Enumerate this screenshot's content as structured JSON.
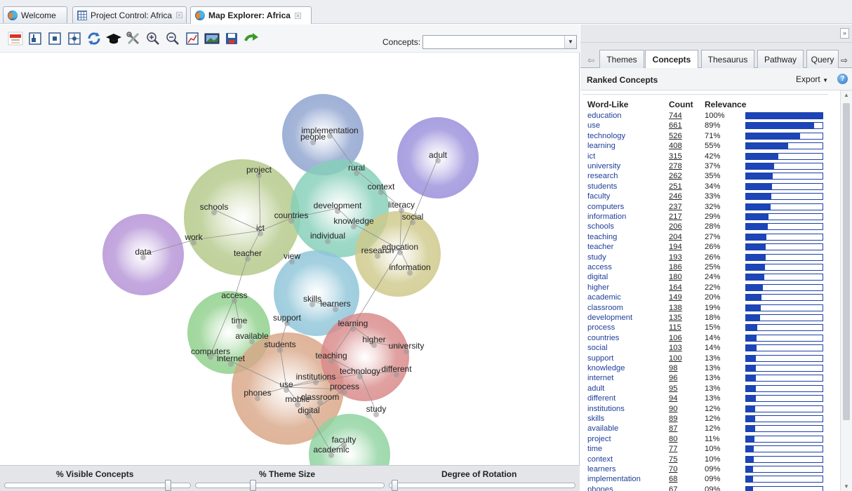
{
  "doc_tabs": [
    {
      "label": "Welcome",
      "icon": "globe-icon",
      "closable": false
    },
    {
      "label": "Project Control: Africa",
      "icon": "table-icon",
      "closable": true
    },
    {
      "label": "Map Explorer: Africa",
      "icon": "globe-icon",
      "closable": true,
      "active": true
    }
  ],
  "toolbar": {
    "concepts_label": "Concepts:",
    "concepts_value": "",
    "icons": [
      "logo-icon",
      "fit-icon",
      "frame-icon",
      "center-icon",
      "refresh-icon",
      "graduation-cap-icon",
      "tools-icon",
      "zoom-in-icon",
      "zoom-out-icon",
      "chart-icon",
      "image-icon",
      "save-icon",
      "forward-arrow-icon"
    ]
  },
  "map": {
    "themes": [
      {
        "name": "implementation",
        "color": "#8ea3cf"
      },
      {
        "name": "adult",
        "color": "#9a8fdb"
      },
      {
        "name": "project",
        "color": "#b5c98a"
      },
      {
        "name": "development",
        "color": "#86cfb9"
      },
      {
        "name": "social",
        "color": "#cfc98a"
      },
      {
        "name": "data",
        "color": "#b593d6"
      },
      {
        "name": "skills",
        "color": "#8fc5d9"
      },
      {
        "name": "access",
        "color": "#8fd08b"
      },
      {
        "name": "use",
        "color": "#d9a788"
      },
      {
        "name": "learning",
        "color": "#d98a8a"
      },
      {
        "name": "study",
        "color": "#8fd3a0"
      }
    ],
    "concepts": [
      "implementation",
      "people",
      "adult",
      "project",
      "rural",
      "context",
      "schools",
      "development",
      "literacy",
      "countries",
      "knowledge",
      "social",
      "ict",
      "work",
      "individual",
      "data",
      "teacher",
      "research",
      "education",
      "view",
      "information",
      "access",
      "skills",
      "learners",
      "support",
      "learning",
      "time",
      "available",
      "higher",
      "university",
      "students",
      "computers",
      "internet",
      "teaching",
      "different",
      "technology",
      "institutions",
      "use",
      "process",
      "phones",
      "mobile",
      "classroom",
      "digital",
      "study",
      "faculty",
      "academic"
    ]
  },
  "bottom": {
    "visible_label": "% Visible Concepts",
    "theme_label": "% Theme Size",
    "rotation_label": "Degree of Rotation",
    "visible_value": 0.9,
    "theme_value": 0.3,
    "rotation_value": 0.01
  },
  "right": {
    "tabs": [
      "Themes",
      "Concepts",
      "Thesaurus",
      "Pathway",
      "Query"
    ],
    "active_tab": "Concepts",
    "panel_title": "Ranked Concepts",
    "export_label": "Export",
    "headers": {
      "word": "Word-Like",
      "count": "Count",
      "relevance": "Relevance"
    },
    "rows": [
      {
        "word": "education",
        "count": "744",
        "relevance": "100%",
        "pct": 100
      },
      {
        "word": "use",
        "count": "661",
        "relevance": "89%",
        "pct": 89
      },
      {
        "word": "technology",
        "count": "526",
        "relevance": "71%",
        "pct": 71
      },
      {
        "word": "learning",
        "count": "408",
        "relevance": "55%",
        "pct": 55
      },
      {
        "word": "ict",
        "count": "315",
        "relevance": "42%",
        "pct": 42
      },
      {
        "word": "university",
        "count": "278",
        "relevance": "37%",
        "pct": 37
      },
      {
        "word": "research",
        "count": "262",
        "relevance": "35%",
        "pct": 35
      },
      {
        "word": "students",
        "count": "251",
        "relevance": "34%",
        "pct": 34
      },
      {
        "word": "faculty",
        "count": "246",
        "relevance": "33%",
        "pct": 33
      },
      {
        "word": "computers",
        "count": "237",
        "relevance": "32%",
        "pct": 32
      },
      {
        "word": "information",
        "count": "217",
        "relevance": "29%",
        "pct": 29
      },
      {
        "word": "schools",
        "count": "206",
        "relevance": "28%",
        "pct": 28
      },
      {
        "word": "teaching",
        "count": "204",
        "relevance": "27%",
        "pct": 27
      },
      {
        "word": "teacher",
        "count": "194",
        "relevance": "26%",
        "pct": 26
      },
      {
        "word": "study",
        "count": "193",
        "relevance": "26%",
        "pct": 26
      },
      {
        "word": "access",
        "count": "186",
        "relevance": "25%",
        "pct": 25
      },
      {
        "word": "digital",
        "count": "180",
        "relevance": "24%",
        "pct": 24
      },
      {
        "word": "higher",
        "count": "164",
        "relevance": "22%",
        "pct": 22
      },
      {
        "word": "academic",
        "count": "149",
        "relevance": "20%",
        "pct": 20
      },
      {
        "word": "classroom",
        "count": "138",
        "relevance": "19%",
        "pct": 19
      },
      {
        "word": "development",
        "count": "135",
        "relevance": "18%",
        "pct": 18
      },
      {
        "word": "process",
        "count": "115",
        "relevance": "15%",
        "pct": 15
      },
      {
        "word": "countries",
        "count": "106",
        "relevance": "14%",
        "pct": 14
      },
      {
        "word": "social",
        "count": "103",
        "relevance": "14%",
        "pct": 14
      },
      {
        "word": "support",
        "count": "100",
        "relevance": "13%",
        "pct": 13
      },
      {
        "word": "knowledge",
        "count": "98",
        "relevance": "13%",
        "pct": 13
      },
      {
        "word": "internet",
        "count": "96",
        "relevance": "13%",
        "pct": 13
      },
      {
        "word": "adult",
        "count": "95",
        "relevance": "13%",
        "pct": 13
      },
      {
        "word": "different",
        "count": "94",
        "relevance": "13%",
        "pct": 13
      },
      {
        "word": "institutions",
        "count": "90",
        "relevance": "12%",
        "pct": 12
      },
      {
        "word": "skills",
        "count": "89",
        "relevance": "12%",
        "pct": 12
      },
      {
        "word": "available",
        "count": "87",
        "relevance": "12%",
        "pct": 12
      },
      {
        "word": "project",
        "count": "80",
        "relevance": "11%",
        "pct": 11
      },
      {
        "word": "time",
        "count": "77",
        "relevance": "10%",
        "pct": 10
      },
      {
        "word": "context",
        "count": "75",
        "relevance": "10%",
        "pct": 10
      },
      {
        "word": "learners",
        "count": "70",
        "relevance": "09%",
        "pct": 9
      },
      {
        "word": "implementation",
        "count": "68",
        "relevance": "09%",
        "pct": 9
      },
      {
        "word": "phones",
        "count": "67",
        "relevance": "09%",
        "pct": 9
      }
    ]
  }
}
